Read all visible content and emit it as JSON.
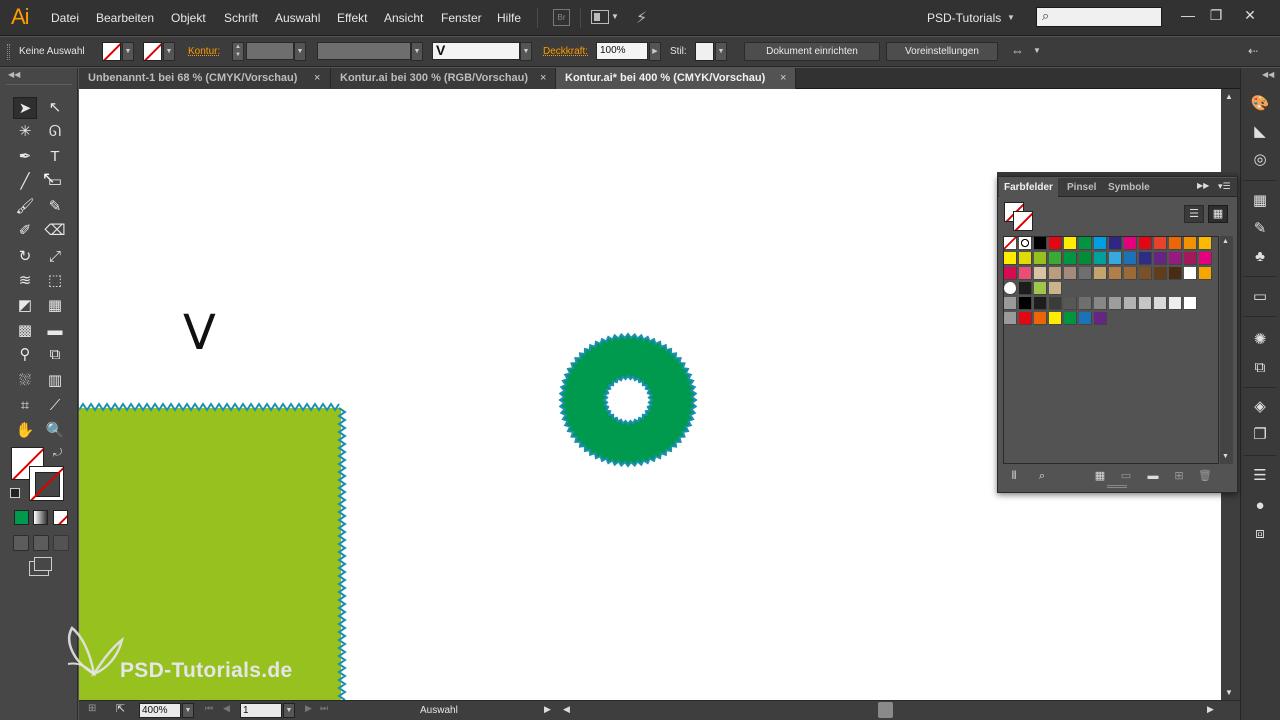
{
  "app": {
    "logo": "Ai",
    "menu": [
      "Datei",
      "Bearbeiten",
      "Objekt",
      "Schrift",
      "Auswahl",
      "Effekt",
      "Ansicht",
      "Fenster",
      "Hilfe"
    ],
    "bridge_label": "Br",
    "workspace": "PSD-Tutorials",
    "window_controls": [
      "—",
      "❐",
      "✕"
    ]
  },
  "controlbar": {
    "selection_status": "Keine Auswahl",
    "stroke_label": "Kontur:",
    "brush_preview": "V",
    "opacity_label": "Deckkraft:",
    "opacity_value": "100%",
    "style_label": "Stil:",
    "document_setup_button": "Dokument einrichten",
    "preferences_button": "Voreinstellungen"
  },
  "tabs": [
    {
      "label": "Unbenannt-1 bei 68 % (CMYK/Vorschau)",
      "active": false
    },
    {
      "label": "Kontur.ai bei 300 % (RGB/Vorschau)",
      "active": false
    },
    {
      "label": "Kontur.ai* bei 400 % (CMYK/Vorschau)",
      "active": true
    }
  ],
  "tab_close_glyph": "×",
  "canvas": {
    "glyph_text": "V",
    "rect_fill": "#96c11f",
    "rect_stroke": "#1a8fb0",
    "gear_fill": "#009a4e",
    "gear_stroke": "#1a8fb0",
    "watermark_text": "PSD-Tutorials.de"
  },
  "statusbar": {
    "zoom": "400%",
    "artboard": "1",
    "status_text": "Auswahl"
  },
  "swatch_panel": {
    "tabs": [
      "Farbfelder",
      "Pinsel",
      "Symbole"
    ],
    "active_tab": "Farbfelder",
    "rows": [
      [
        "#ffffff",
        "#ffffff",
        "#000000",
        "#e30613",
        "#ffed00",
        "#009640",
        "#009fe3",
        "#312783",
        "#e6007e",
        "#e30613",
        "#e8412c",
        "#ec6608",
        "#f39200",
        "#fbba00"
      ],
      [
        "#ffed00",
        "#dedc00",
        "#95c11f",
        "#3aaa35",
        "#009640",
        "#008d36",
        "#00a19a",
        "#36a9e1",
        "#1d71b8",
        "#2d2e83",
        "#662483",
        "#951b81",
        "#a3195b",
        "#e6007e"
      ],
      [
        "#d60b52",
        "#e94e77",
        "#d9c3a5",
        "#b99d7c",
        "#a48a7b",
        "#706f6f",
        "#c3a46e",
        "#b17f4a",
        "#9d6a37",
        "#7c5127",
        "#623d1a",
        "#4a2c13",
        "#ffffff",
        "#f7a600"
      ],
      [
        "#1d1d1b",
        "#9fc54d",
        "#c9b48c"
      ],
      [
        "#000000",
        "#1d1d1b",
        "#3c3c3b",
        "#575756",
        "#706f6f",
        "#878787",
        "#9d9d9c",
        "#b2b2b2",
        "#c6c6c6",
        "#dadada",
        "#ededed",
        "#ffffff"
      ],
      [
        "#e30613",
        "#ec6608",
        "#ffed00",
        "#009640",
        "#1d71b8",
        "#662483"
      ]
    ]
  },
  "dock_icons": [
    "color-guide-icon",
    "gradient-icon",
    "appearance-icon",
    "swatch-libraries-icon",
    "brushes-icon",
    "symbols-icon",
    "transparency-icon",
    "stroke-icon",
    "pathfinder-icon",
    "layers-icon",
    "artboards-icon",
    "align-icon",
    "graphic-styles-icon",
    "transform-icon"
  ]
}
